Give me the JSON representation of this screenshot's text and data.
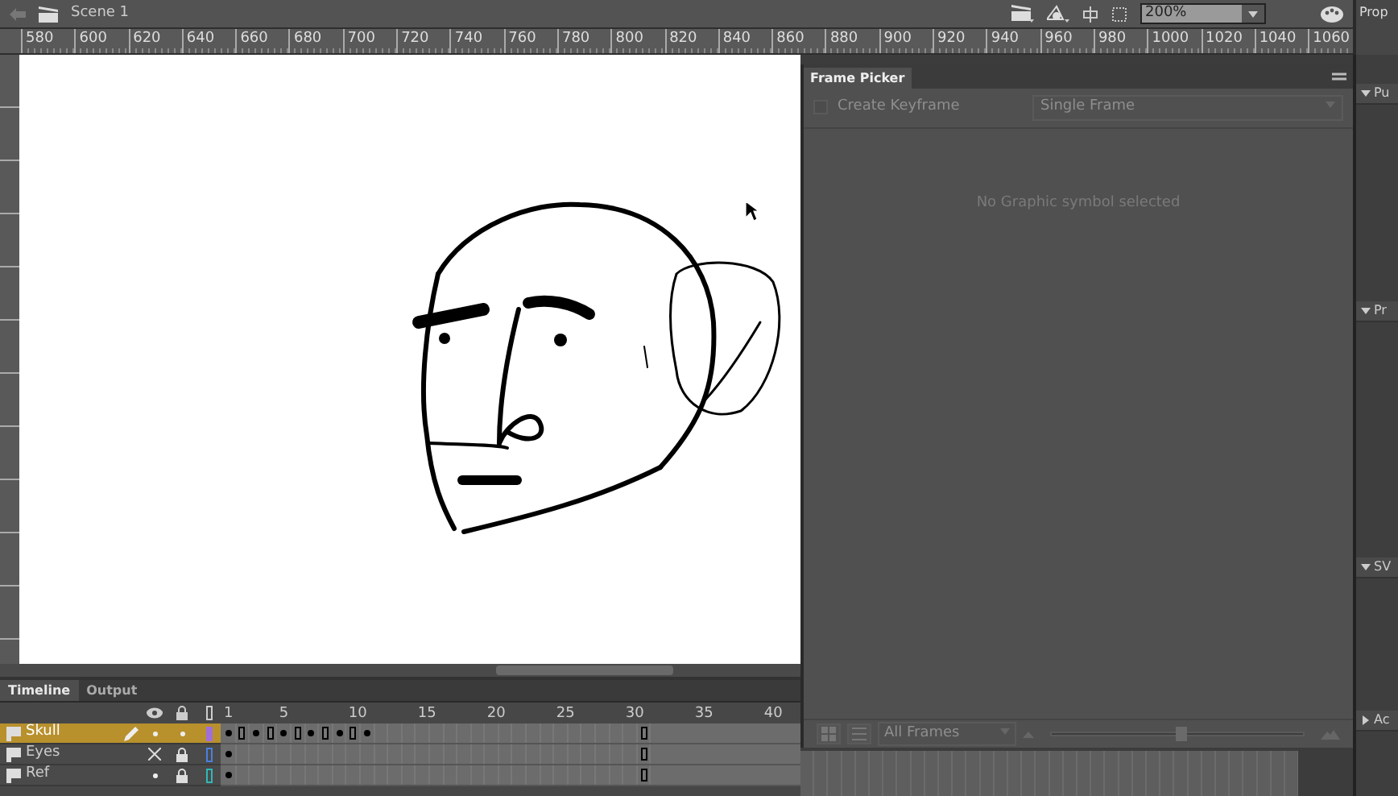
{
  "top_bar": {
    "scene": "Scene 1",
    "zoom": "200%",
    "panel_title": "Prop"
  },
  "ruler": {
    "labels": [
      "580",
      "600",
      "620",
      "640",
      "660",
      "680",
      "700",
      "720",
      "740",
      "760",
      "780",
      "800",
      "820",
      "840",
      "860",
      "880",
      "900",
      "920",
      "940",
      "960",
      "980",
      "1000",
      "1020",
      "1040",
      "1060"
    ]
  },
  "frame_picker": {
    "tab": "Frame Picker",
    "create_keyframe": {
      "label": "Create Keyframe",
      "checked": false
    },
    "mode": "Single Frame",
    "message": "No Graphic symbol selected",
    "filter": "All Frames",
    "size": {
      "level": 0.51
    }
  },
  "side_panels": [
    {
      "title": "Pu",
      "expanded": true
    },
    {
      "title": "Pr",
      "expanded": true
    },
    {
      "title": "SV",
      "expanded": true
    },
    {
      "title": "Ac",
      "expanded": false
    }
  ],
  "timeline": {
    "tabs": [
      {
        "label": "Timeline",
        "selected": true
      },
      {
        "label": "Output",
        "selected": false
      }
    ],
    "frame_labels": [
      "1",
      "5",
      "10",
      "15",
      "20",
      "25",
      "30",
      "35",
      "40"
    ],
    "layers": [
      {
        "name": "Skull",
        "selected": true,
        "hidden": false,
        "locked": false,
        "color": "#a070d8",
        "frames": [
          {
            "kind": "key"
          },
          {
            "kind": "end"
          },
          {
            "kind": "key"
          },
          {
            "kind": "end"
          },
          {
            "kind": "key"
          },
          {
            "kind": "end"
          },
          {
            "kind": "key"
          },
          {
            "kind": "end"
          },
          {
            "kind": "key"
          },
          {
            "kind": "end"
          },
          {
            "kind": "key"
          },
          {
            "kind": "blank"
          },
          {
            "kind": "blank"
          },
          {
            "kind": "blank"
          },
          {
            "kind": "blank"
          },
          {
            "kind": "blank"
          },
          {
            "kind": "blank"
          },
          {
            "kind": "blank"
          },
          {
            "kind": "blank"
          },
          {
            "kind": "blank"
          },
          {
            "kind": "blank"
          },
          {
            "kind": "blank"
          },
          {
            "kind": "blank"
          },
          {
            "kind": "blank"
          },
          {
            "kind": "blank"
          },
          {
            "kind": "blank"
          },
          {
            "kind": "blank"
          },
          {
            "kind": "blank"
          },
          {
            "kind": "blank"
          },
          {
            "kind": "blank"
          },
          {
            "kind": "end"
          }
        ]
      },
      {
        "name": "Eyes",
        "selected": false,
        "hidden": true,
        "locked": true,
        "color": "#4a80e0",
        "frames": [
          {
            "kind": "key"
          },
          {
            "kind": "blank"
          },
          {
            "kind": "blank"
          },
          {
            "kind": "blank"
          },
          {
            "kind": "blank"
          },
          {
            "kind": "blank"
          },
          {
            "kind": "blank"
          },
          {
            "kind": "blank"
          },
          {
            "kind": "blank"
          },
          {
            "kind": "blank"
          },
          {
            "kind": "blank"
          },
          {
            "kind": "blank"
          },
          {
            "kind": "blank"
          },
          {
            "kind": "blank"
          },
          {
            "kind": "blank"
          },
          {
            "kind": "blank"
          },
          {
            "kind": "blank"
          },
          {
            "kind": "blank"
          },
          {
            "kind": "blank"
          },
          {
            "kind": "blank"
          },
          {
            "kind": "blank"
          },
          {
            "kind": "blank"
          },
          {
            "kind": "blank"
          },
          {
            "kind": "blank"
          },
          {
            "kind": "blank"
          },
          {
            "kind": "blank"
          },
          {
            "kind": "blank"
          },
          {
            "kind": "blank"
          },
          {
            "kind": "blank"
          },
          {
            "kind": "blank"
          },
          {
            "kind": "end"
          }
        ]
      },
      {
        "name": "Ref",
        "selected": false,
        "hidden": false,
        "locked": true,
        "color": "#30b8b8",
        "frames": [
          {
            "kind": "key"
          },
          {
            "kind": "blank"
          },
          {
            "kind": "blank"
          },
          {
            "kind": "blank"
          },
          {
            "kind": "blank"
          },
          {
            "kind": "blank"
          },
          {
            "kind": "blank"
          },
          {
            "kind": "blank"
          },
          {
            "kind": "blank"
          },
          {
            "kind": "blank"
          },
          {
            "kind": "blank"
          },
          {
            "kind": "blank"
          },
          {
            "kind": "blank"
          },
          {
            "kind": "blank"
          },
          {
            "kind": "blank"
          },
          {
            "kind": "blank"
          },
          {
            "kind": "blank"
          },
          {
            "kind": "blank"
          },
          {
            "kind": "blank"
          },
          {
            "kind": "blank"
          },
          {
            "kind": "blank"
          },
          {
            "kind": "blank"
          },
          {
            "kind": "blank"
          },
          {
            "kind": "blank"
          },
          {
            "kind": "blank"
          },
          {
            "kind": "blank"
          },
          {
            "kind": "blank"
          },
          {
            "kind": "blank"
          },
          {
            "kind": "blank"
          },
          {
            "kind": "blank"
          },
          {
            "kind": "end"
          }
        ]
      }
    ]
  }
}
